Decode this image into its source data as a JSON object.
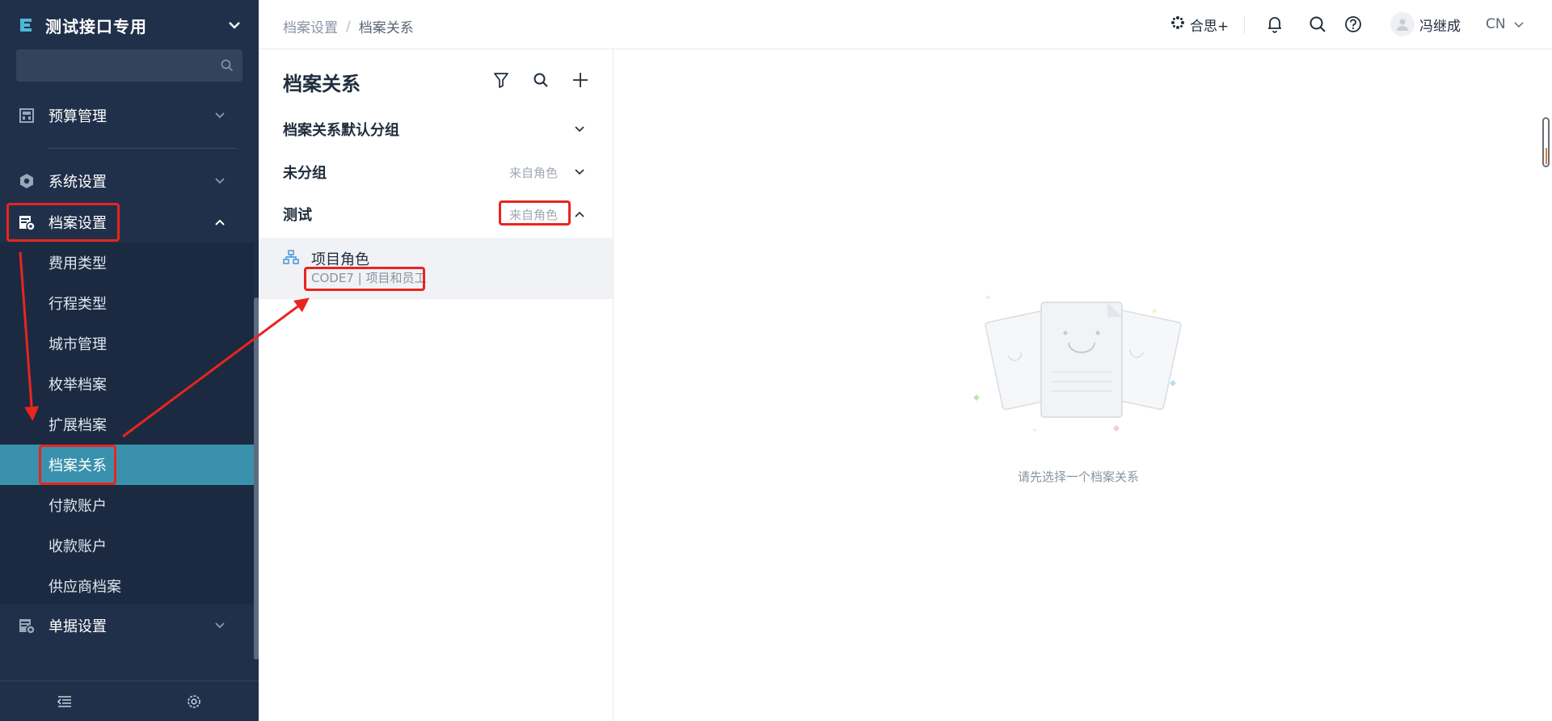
{
  "sidebar": {
    "brand": "测试接口专用",
    "search_placeholder": "",
    "menu": {
      "budget": "预算管理",
      "system": "系统设置",
      "archive": "档案设置",
      "document": "单据设置"
    },
    "sub_items": [
      "费用类型",
      "行程类型",
      "城市管理",
      "枚举档案",
      "扩展档案",
      "档案关系",
      "付款账户",
      "收款账户",
      "供应商档案"
    ],
    "active_sub": "档案关系"
  },
  "header": {
    "breadcrumb": [
      "档案设置",
      "档案关系"
    ],
    "hs_plus": "合思+",
    "user_name": "冯继成",
    "language": "CN"
  },
  "middle": {
    "title": "档案关系",
    "groups": [
      {
        "name": "档案关系默认分组",
        "tag": ""
      },
      {
        "name": "未分组",
        "tag": "来自角色"
      },
      {
        "name": "测试",
        "tag": "来自角色"
      }
    ],
    "selected_item": {
      "name": "项目角色",
      "subtitle": "CODE7 | 项目和员工"
    }
  },
  "main": {
    "empty_text": "请先选择一个档案关系"
  },
  "colors": {
    "sidebar_bg": "#21304a",
    "active_item": "#3a91ad",
    "annotation": "#e8251f"
  }
}
